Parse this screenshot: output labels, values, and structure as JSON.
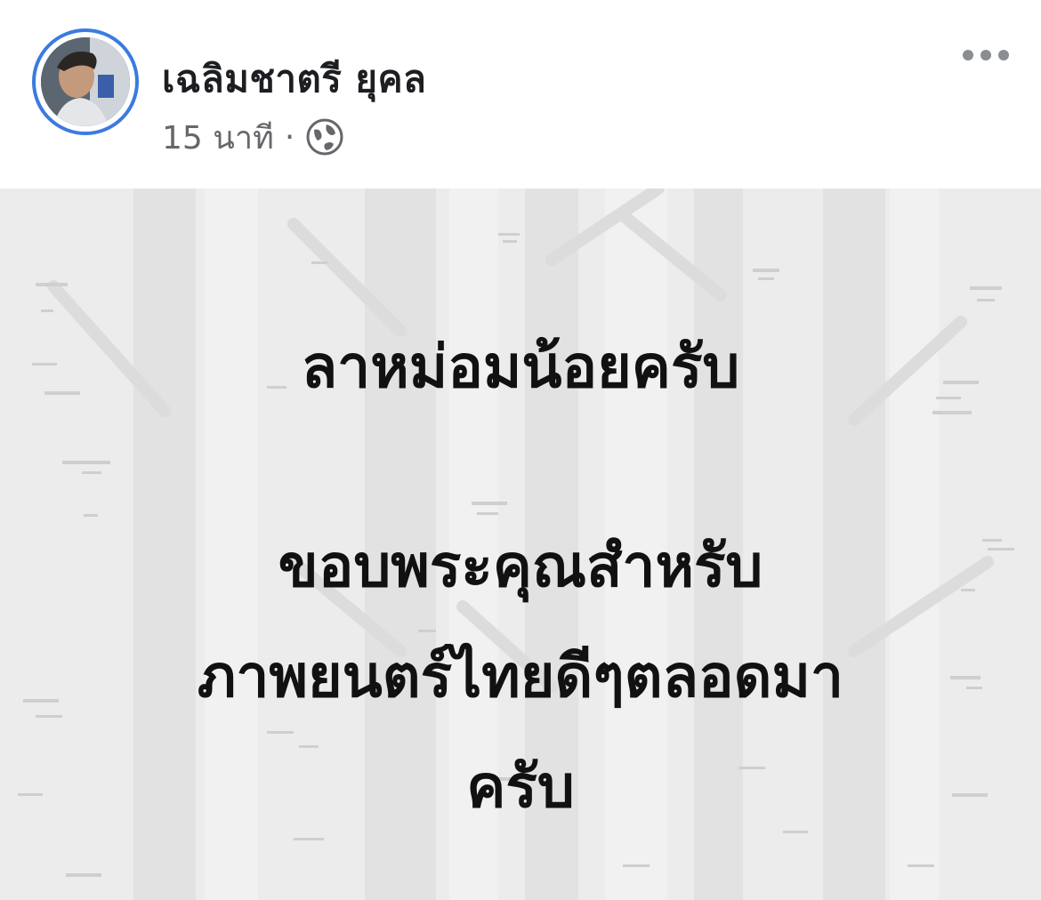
{
  "post": {
    "author_name": "เฉลิมชาตรี ยุคล",
    "time": "15 นาที",
    "separator": "·",
    "privacy_icon": "globe-icon",
    "more_icon": "more-options-icon",
    "lines": [
      "ลาหม่อมน้อยครับ",
      "ขอบพระคุณสำหรับ",
      "ภาพยนตร์ไทยดีๆตลอดมา",
      "ครับ"
    ]
  },
  "colors": {
    "avatar_ring": "#3b7be0",
    "background": "#ececec",
    "text": "#111111",
    "meta_text": "#65676b"
  }
}
